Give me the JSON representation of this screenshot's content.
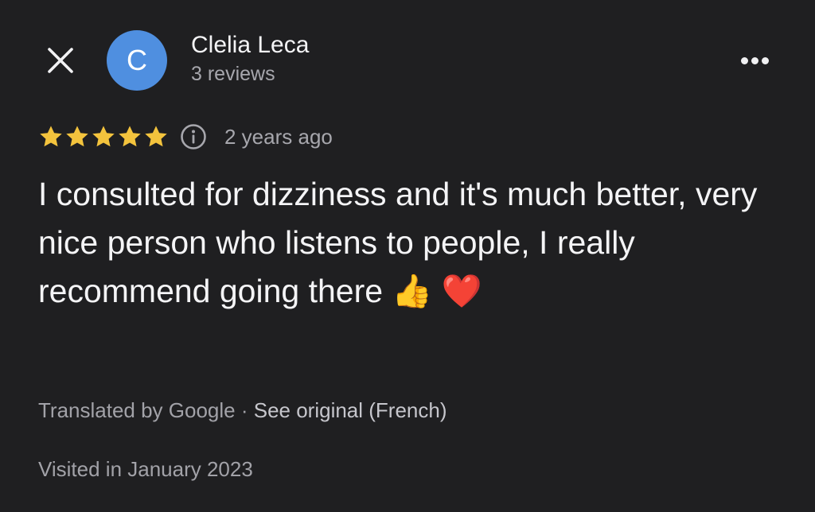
{
  "header": {
    "close_icon": "close-icon",
    "avatar_letter": "C",
    "avatar_color": "#4f8fe0",
    "author_name": "Clelia Leca",
    "author_reviews": "3 reviews",
    "more_icon": "more-horizontal-icon"
  },
  "rating": {
    "stars": 5,
    "max_stars": 5,
    "star_color": "#f3c33d",
    "info_icon": "info-icon",
    "date": "2 years ago"
  },
  "review": {
    "text": "I consulted for dizziness and it's much better, very nice person who listens to people, I really recommend going there 👍 ❤️"
  },
  "translation": {
    "translated_by": "Translated by Google",
    "separator": " · ",
    "see_original": "See original (French)"
  },
  "visited": "Visited in January 2023"
}
